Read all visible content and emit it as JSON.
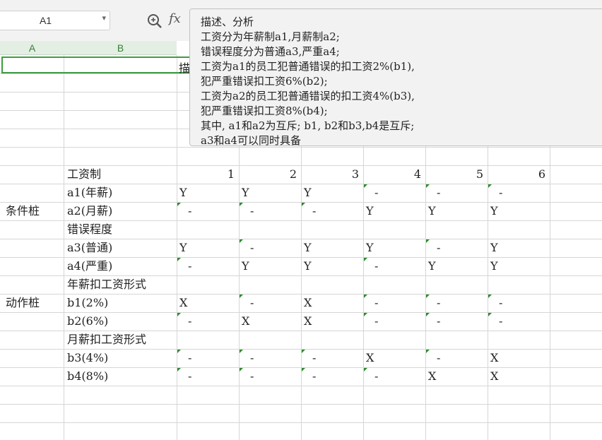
{
  "toolbar": {
    "name_box_value": "A1",
    "name_box_arrow": "▾",
    "zoom_icon": "zoom-search-icon",
    "fx_label": "fx"
  },
  "formula_popup": {
    "lines": [
      "描述、分析",
      "工资分为年薪制a1,月薪制a2;",
      "错误程度分为普通a3,严重a4;",
      "工资为a1的员工犯普通错误的扣工资2%(b1),",
      "犯严重错误扣工资6%(b2);",
      "工资为a2的员工犯普通错误的扣工资4%(b3),",
      "犯严重错误扣工资8%(b4);",
      "其中, a1和a2为互斥; b1, b2和b3,b4是互斥;",
      "a3和a4可以同时具备"
    ]
  },
  "columns": [
    "A",
    "B"
  ],
  "sheet": {
    "title_visible_fragment": "描",
    "header_row": {
      "label": "工资制",
      "rule_numbers": [
        "1",
        "2",
        "3",
        "4",
        "5",
        "6"
      ]
    },
    "rows": [
      {
        "a": "",
        "b": "a1(年薪)",
        "cells": [
          "Y",
          "Y",
          "Y",
          "-",
          "-",
          "-"
        ]
      },
      {
        "a": "条件桩",
        "b": "a2(月薪)",
        "cells": [
          "-",
          "-",
          "-",
          "Y",
          "Y",
          "Y"
        ]
      },
      {
        "a": "",
        "b": "错误程度",
        "cells": [
          "",
          "",
          "",
          "",
          "",
          ""
        ]
      },
      {
        "a": "",
        "b": "a3(普通)",
        "cells": [
          "Y",
          "-",
          "Y",
          "Y",
          "-",
          "Y"
        ]
      },
      {
        "a": "",
        "b": "a4(严重)",
        "cells": [
          "-",
          "Y",
          "Y",
          "-",
          "Y",
          "Y"
        ]
      },
      {
        "a": "",
        "b": "年薪扣工资形式",
        "cells": [
          "",
          "",
          "",
          "",
          "",
          ""
        ]
      },
      {
        "a": "动作桩",
        "b": "b1(2%)",
        "cells": [
          "X",
          "-",
          "X",
          "-",
          "-",
          "-"
        ]
      },
      {
        "a": "",
        "b": "b2(6%)",
        "cells": [
          "-",
          "X",
          "X",
          "-",
          "-",
          "-"
        ]
      },
      {
        "a": "",
        "b": "月薪扣工资形式",
        "cells": [
          "",
          "",
          "",
          "",
          "",
          ""
        ]
      },
      {
        "a": "",
        "b": "b3(4%)",
        "cells": [
          "-",
          "-",
          "-",
          "X",
          "-",
          "X"
        ]
      },
      {
        "a": "",
        "b": "b4(8%)",
        "cells": [
          "-",
          "-",
          "-",
          "-",
          "X",
          "X"
        ]
      }
    ]
  },
  "colors": {
    "selection_border": "#3e9b42",
    "error_indicator": "#2e8b2e",
    "column_header_bg": "#e3efe3"
  }
}
